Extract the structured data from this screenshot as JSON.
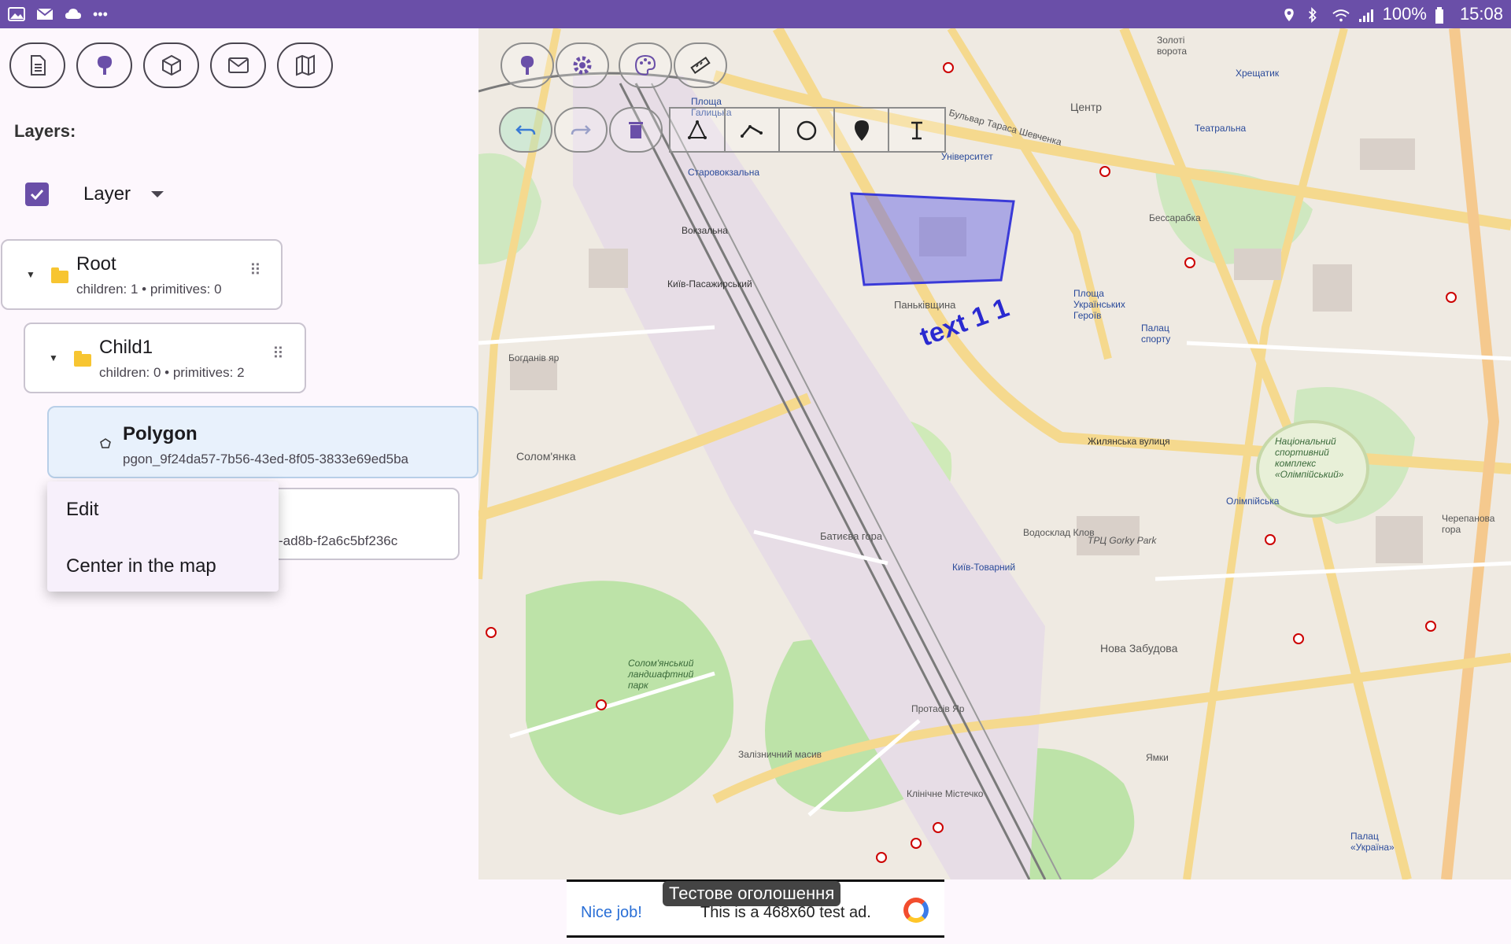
{
  "statusbar": {
    "left_icons": [
      "gallery-icon",
      "mail-icon",
      "cloud-icon",
      "more-icon"
    ],
    "more": "•••",
    "battery": "100%",
    "time": "15:08"
  },
  "toolbar": {
    "buttons": [
      "document-icon",
      "tree-icon",
      "cube-icon",
      "mail-icon",
      "map-icon"
    ]
  },
  "layers": {
    "title": "Layers:",
    "layer_name": "Layer",
    "checked": true
  },
  "tree": {
    "root": {
      "title": "Root",
      "sub": "children: 1 • primitives: 0"
    },
    "child1": {
      "title": "Child1",
      "sub": "children: 0 • primitives: 2"
    },
    "polygon": {
      "title": "Polygon",
      "sub": "pgon_9f24da57-7b56-43ed-8f05-3833e69ed5ba"
    },
    "hidden_item": {
      "sub": "-ad8b-f2a6c5bf236c"
    }
  },
  "context_menu": {
    "items": [
      "Edit",
      "Center in the map"
    ]
  },
  "map": {
    "annotation_text": "text 1 1",
    "polygon_color": "#3a3ad8",
    "labels": {
      "l1": "Солом'янка",
      "l2": "Богданів яр",
      "l3": "Київ-Пасажирський",
      "l4": "Вокзальна",
      "l5": "Паньківщина",
      "l6": "Жилянська вулиця",
      "l7": "Батиєва гора",
      "l8": "Київ-Товарний",
      "l9": "Олімпійська",
      "l10": "Нова Забудова",
      "l11": "Протасів Яр",
      "l12": "Залізничний масив",
      "l13": "Солом'янський ландшафтний парк",
      "l14": "Центр",
      "l15": "Університет",
      "l16": "Бессарабка",
      "l17": "Площа Українських Героїв",
      "l18": "Палац спорту",
      "l19": "Національний спортивний комплекс «Олімпійський»",
      "l20": "Бульвар Тараса Шевченка",
      "l21": "Золоті ворота",
      "l22": "Хрещатик",
      "l23": "Театральна",
      "l24": "Черепанова гора",
      "l25": "Водосклад Клов",
      "l26": "ТРЦ Gorky Park",
      "l27": "Клінічне Містечко",
      "l28": "Палац «Україна»",
      "l29": "Ямки",
      "l30": "Старовокзальна",
      "l31": "Площа Галицька"
    },
    "tools": {
      "top": [
        "pin-icon",
        "settings-icon",
        "palette-icon",
        "ruler-icon"
      ],
      "second": [
        "undo-icon",
        "redo-icon",
        "delete-icon",
        "polygon-tool-icon",
        "polyline-tool-icon",
        "circle-tool-icon",
        "marker-tool-icon",
        "text-tool-icon"
      ]
    }
  },
  "ad": {
    "tooltip": "Тестове оголошення",
    "nice": "Nice job!",
    "text": "This is a 468x60 test ad."
  }
}
